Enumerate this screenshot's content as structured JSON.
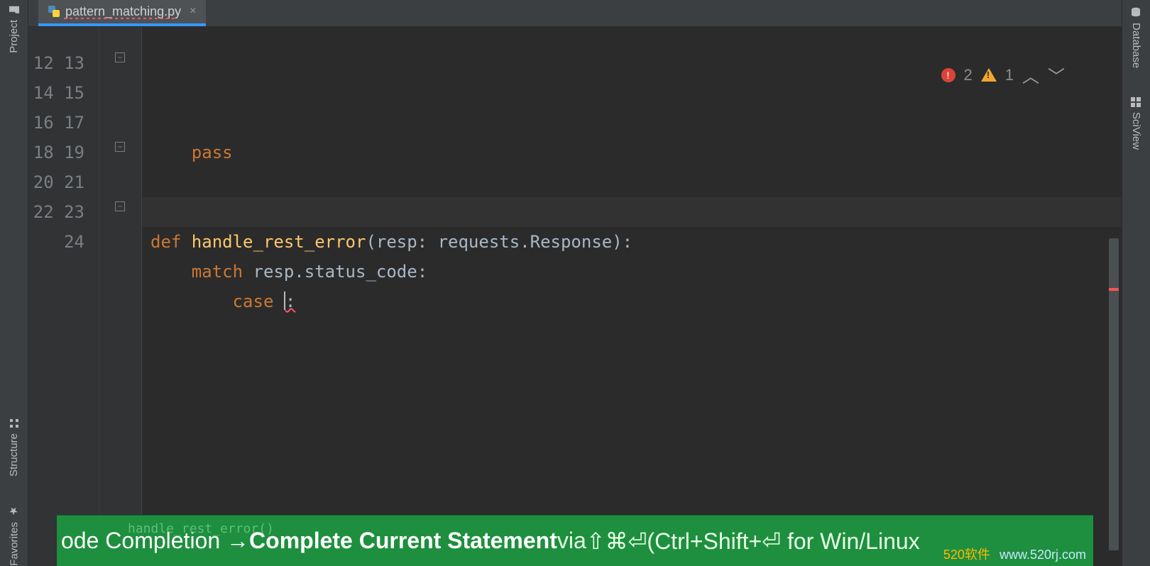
{
  "left_rail": {
    "project": "Project",
    "structure": "Structure",
    "favorites": "Favorites"
  },
  "right_rail": {
    "database": "Database",
    "sciview": "SciView"
  },
  "tab": {
    "title": "pattern_matching.py"
  },
  "gutter": {
    "start": 12,
    "end": 24
  },
  "code": {
    "l12": {
      "kw": "pass"
    },
    "l15": {
      "def": "def ",
      "fn": "handle_rest_error",
      "rest": "(resp: requests.Response):"
    },
    "l16": {
      "kw": "match ",
      "rest": "resp.status_code:"
    },
    "l17": {
      "kw": "case ",
      "rest": ":"
    }
  },
  "inspection": {
    "errors": "2",
    "warnings": "1"
  },
  "banner": {
    "ghost": "handle_rest_error()",
    "pre": "ode Completion → ",
    "bold": "Complete Current Statement",
    "via": " via ",
    "keys_mac": "⇧⌘⏎",
    "rest": " (Ctrl+Shift+⏎ for Win/Linux"
  },
  "watermark": {
    "cn": "520软件",
    "url": "www.520rj.com"
  }
}
